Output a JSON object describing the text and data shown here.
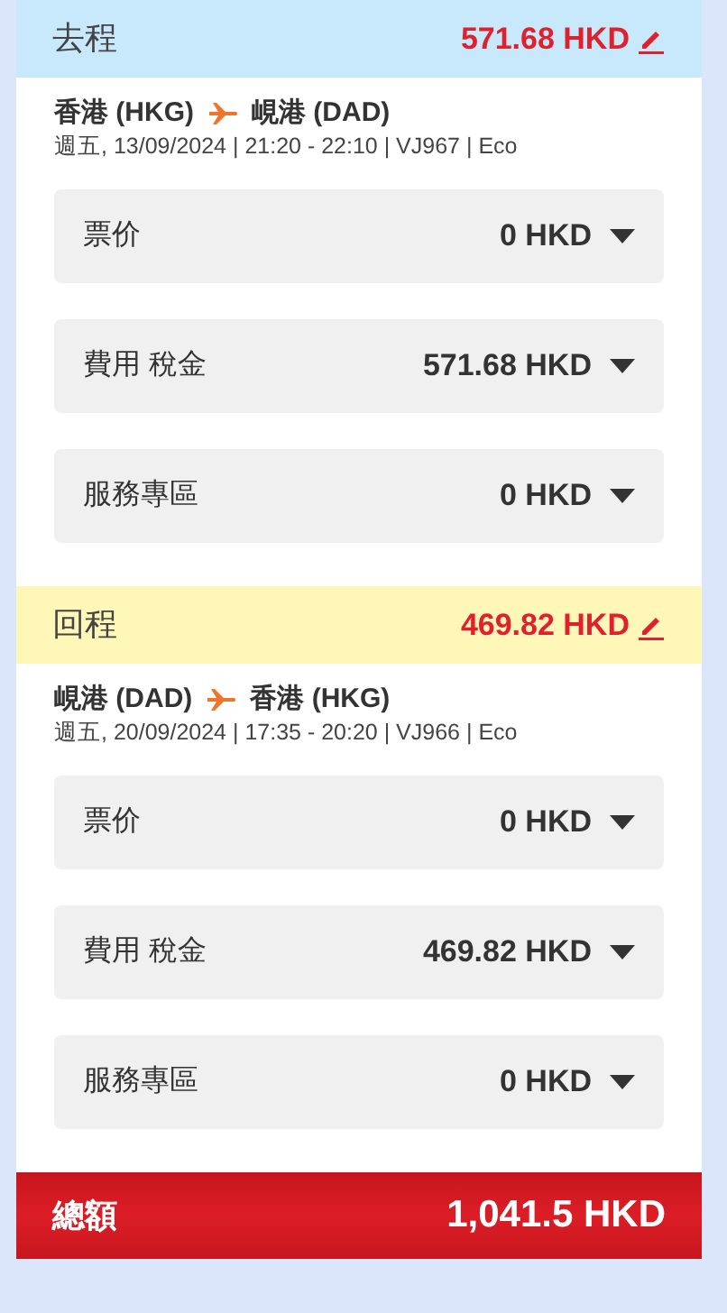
{
  "sections": [
    {
      "title": "去程",
      "amount": "571.68 HKD",
      "color": "#c7e9fb",
      "from": "香港 (HKG)",
      "to": "峴港 (DAD)",
      "details": "週五, 13/09/2024 | 21:20 - 22:10 | VJ967 | Eco",
      "rows": [
        {
          "label": "票价",
          "amount": "0 HKD",
          "expanded": false
        },
        {
          "label": "費用 稅金",
          "amount": "571.68 HKD",
          "expanded": false
        },
        {
          "label": "服務專區",
          "amount": "0 HKD",
          "expanded": false
        }
      ]
    },
    {
      "title": "回程",
      "amount": "469.82 HKD",
      "color": "#fef7b8",
      "from": "峴港 (DAD)",
      "to": "香港 (HKG)",
      "details": "週五, 20/09/2024 | 17:35 - 20:20 | VJ966 | Eco",
      "rows": [
        {
          "label": "票价",
          "amount": "0 HKD",
          "expanded": false
        },
        {
          "label": "費用 稅金",
          "amount": "469.82 HKD",
          "expanded": false
        },
        {
          "label": "服務專區",
          "amount": "0 HKD",
          "expanded": false
        }
      ]
    }
  ],
  "total": {
    "label": "總額",
    "amount": "1,041.5 HKD"
  }
}
